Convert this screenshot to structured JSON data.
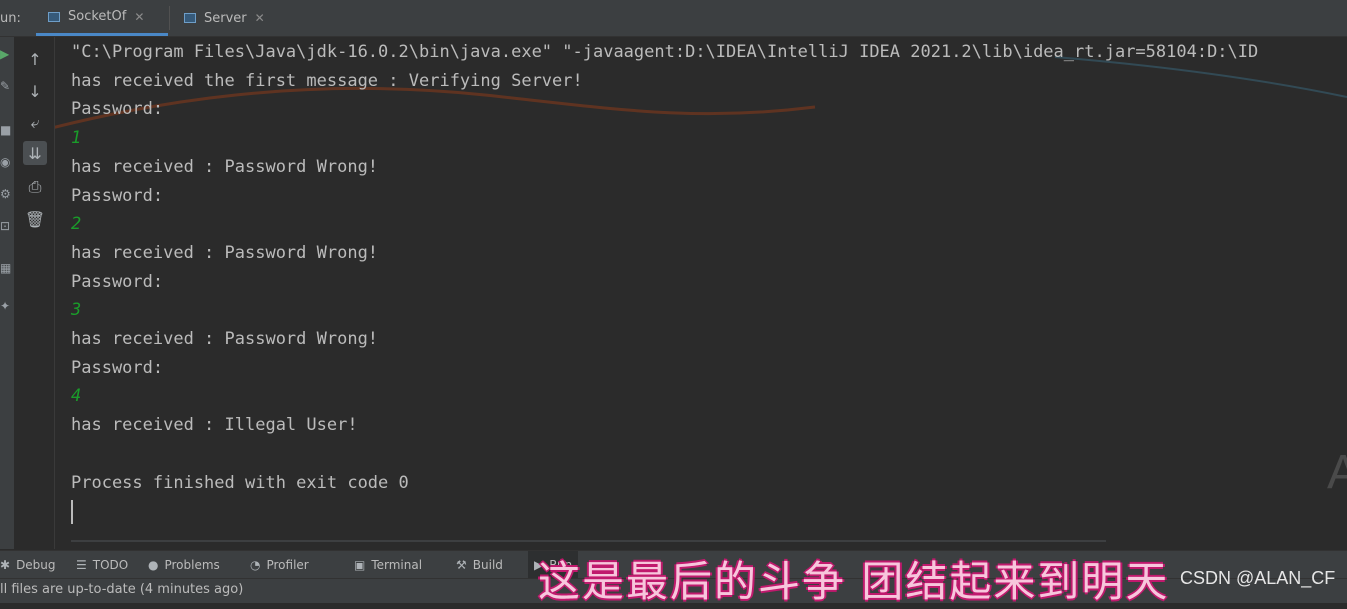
{
  "run_panel": {
    "label": "un:",
    "tabs": [
      {
        "label": "SocketOf",
        "active": true
      },
      {
        "label": "Server",
        "active": false
      }
    ]
  },
  "toolbar_icons": [
    "up-arrow-icon",
    "down-arrow-icon",
    "soft-wrap-icon",
    "scroll-to-end-icon",
    "print-icon",
    "trash-icon"
  ],
  "console": {
    "lines": [
      {
        "text": "\"C:\\Program Files\\Java\\jdk-16.0.2\\bin\\java.exe\" \"-javaagent:D:\\IDEA\\IntelliJ IDEA 2021.2\\lib\\idea_rt.jar=58104:D:\\ID",
        "type": "output"
      },
      {
        "text": "has received the first message : Verifying Server!",
        "type": "output"
      },
      {
        "text": "Password:",
        "type": "output"
      },
      {
        "text": "1",
        "type": "input"
      },
      {
        "text": "has received : Password Wrong!",
        "type": "output"
      },
      {
        "text": "Password:",
        "type": "output"
      },
      {
        "text": "2",
        "type": "input"
      },
      {
        "text": "has received : Password Wrong!",
        "type": "output"
      },
      {
        "text": "Password:",
        "type": "output"
      },
      {
        "text": "3",
        "type": "input"
      },
      {
        "text": "has received : Password Wrong!",
        "type": "output"
      },
      {
        "text": "Password:",
        "type": "output"
      },
      {
        "text": "4",
        "type": "input"
      },
      {
        "text": "has received : Illegal User!",
        "type": "output"
      },
      {
        "text": "",
        "type": "output"
      },
      {
        "text": "Process finished with exit code 0",
        "type": "output"
      }
    ],
    "watermark_letter": "A"
  },
  "bottom_tools": [
    {
      "label": "Debug",
      "icon": "bug-icon"
    },
    {
      "label": "TODO",
      "icon": "list-icon"
    },
    {
      "label": "Problems",
      "icon": "info-icon"
    },
    {
      "label": "Profiler",
      "icon": "gauge-icon"
    },
    {
      "label": "Terminal",
      "icon": "terminal-icon"
    },
    {
      "label": "Build",
      "icon": "hammer-icon"
    },
    {
      "label": "Run",
      "icon": "play-icon",
      "active": true
    }
  ],
  "status": {
    "text": "ll files are up-to-date (4 minutes ago)"
  },
  "overlay": {
    "subtitle": "这是最后的斗争 团结起来到明天",
    "watermark": "CSDN @ALAN_CF"
  },
  "colors": {
    "background": "#2b2b2b",
    "panel": "#3c3f41",
    "text": "#bbbbbb",
    "user_input": "#1a9c2a",
    "active_tab_underline": "#4a88c7"
  }
}
